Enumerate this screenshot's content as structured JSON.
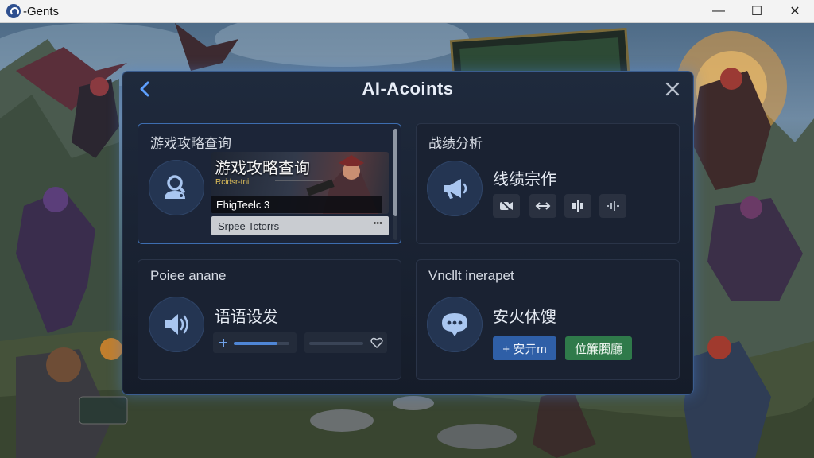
{
  "window": {
    "title": "-Gents",
    "minimize_glyph": "—",
    "maximize_glyph": "☐",
    "close_glyph": "✕"
  },
  "dialog": {
    "title": "AI-Acoints",
    "accent_color": "#3b5d8f"
  },
  "cards": [
    {
      "title": "游戏攻略查询",
      "icon": "user-search-icon",
      "banner_title": "游戏攻略查询",
      "banner_subtitle": "Rcidsr-tni",
      "banner_row": "EhigTeelc 3",
      "select_value": "Srpee Tctorrs",
      "select_suffix": "•••"
    },
    {
      "title": "战绩分析",
      "icon": "megaphone-icon",
      "subtitle": "线绩宗作",
      "controls": [
        "camera-mute-icon",
        "arrows-icon",
        "split-icon",
        "waveform-icon"
      ]
    },
    {
      "title": "Poiee anane",
      "icon": "speaker-icon",
      "subtitle": "语语设发",
      "slider_level": 0.78,
      "slider2_icon": "heart-icon"
    },
    {
      "title": "Vncllt inerapet",
      "icon": "chat-bubble-icon",
      "subtitle": "安火体馊",
      "primary_button": "+ 安亓m",
      "green_button": "位簾臅廳",
      "primary_color": "#2f5fa7",
      "green_color": "#2f7a4a"
    }
  ]
}
